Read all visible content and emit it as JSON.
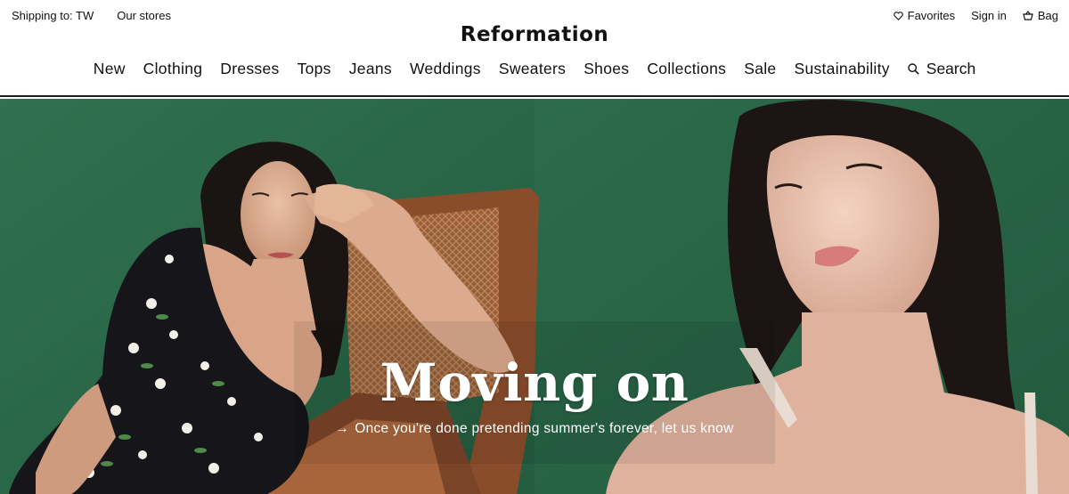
{
  "header": {
    "shipping": "Shipping to: TW",
    "stores": "Our stores",
    "favorites": "Favorites",
    "signin": "Sign in",
    "bag": "Bag",
    "logo": "Reformation"
  },
  "nav": {
    "items": [
      "New",
      "Clothing",
      "Dresses",
      "Tops",
      "Jeans",
      "Weddings",
      "Sweaters",
      "Shoes",
      "Collections",
      "Sale",
      "Sustainability"
    ],
    "search": "Search"
  },
  "hero": {
    "title": "Moving on",
    "arrow": "→",
    "subtitle": "Once you're done pretending summer's forever, let us know",
    "bg_color": "#2c6a4c"
  }
}
